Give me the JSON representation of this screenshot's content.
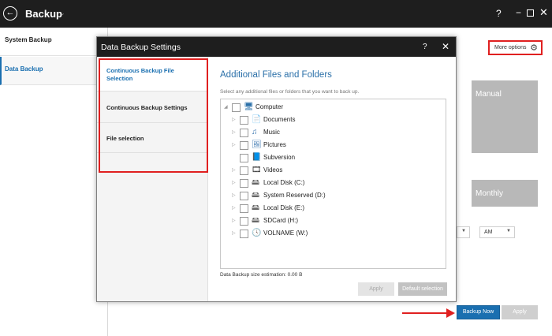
{
  "app": {
    "title": "Backup",
    "help": "?",
    "minimize": "−",
    "close": "✕",
    "back": "←",
    "chevron": "⌄"
  },
  "nav": {
    "items": [
      {
        "label": "System Backup"
      },
      {
        "label": "Data Backup"
      }
    ]
  },
  "main": {
    "more_options": "More options",
    "tile_manual": "Manual",
    "tile_monthly": "Monthly",
    "ampm_value": "AM",
    "backup_now": "Backup Now",
    "apply": "Apply"
  },
  "dialog": {
    "title": "Data Backup Settings",
    "help": "?",
    "close": "✕",
    "sidebar": [
      {
        "label": "Continuous Backup File Selection"
      },
      {
        "label": "Continuous Backup Settings"
      },
      {
        "label": "File selection"
      }
    ],
    "heading": "Additional Files and Folders",
    "subtitle": "Select any additional files or folders that you want to back up.",
    "tree": [
      {
        "label": "Computer",
        "icon": "computer-icon",
        "glyph": "🖥"
      },
      {
        "label": "Documents",
        "icon": "documents-icon",
        "glyph": "📄"
      },
      {
        "label": "Music",
        "icon": "music-icon",
        "glyph": "♫"
      },
      {
        "label": "Pictures",
        "icon": "pictures-icon",
        "glyph": "🖼"
      },
      {
        "label": "Subversion",
        "icon": "subversion-icon",
        "glyph": "📘"
      },
      {
        "label": "Videos",
        "icon": "videos-icon",
        "glyph": "🎞"
      },
      {
        "label": "Local Disk (C:)",
        "icon": "drive-icon",
        "glyph": "🖴"
      },
      {
        "label": "System Reserved (D:)",
        "icon": "drive-icon",
        "glyph": "🖴"
      },
      {
        "label": "Local Disk (E:)",
        "icon": "drive-icon",
        "glyph": "🖴"
      },
      {
        "label": "SDCard (H:)",
        "icon": "sdcard-icon",
        "glyph": "🖴"
      },
      {
        "label": "VOLNAME (W:)",
        "icon": "volume-icon",
        "glyph": "🕓"
      }
    ],
    "estimation": "Data Backup size estimation: 0.00 B",
    "apply": "Apply",
    "default_selection": "Default selection"
  },
  "colors": {
    "accent": "#1a6fb0",
    "highlight_red": "#e02020",
    "titlebar": "#1e1e1e",
    "heading": "#2a6fa8",
    "tile": "#b8b8b8"
  }
}
